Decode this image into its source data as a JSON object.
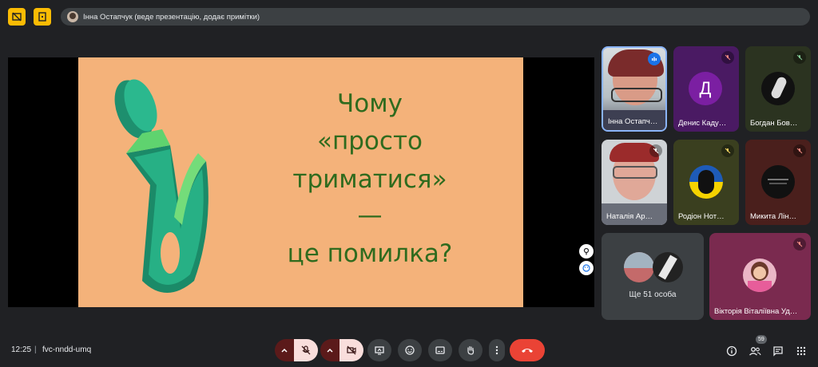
{
  "top_bar": {
    "presenter_label": "Інна Остапчук (веде презентацію, додає примітки)"
  },
  "slide": {
    "line1": "Чому",
    "line2": "«просто",
    "line3": "триматися»",
    "line4": "—",
    "line5": "це  помилка?"
  },
  "participants": {
    "tiles": [
      {
        "name": "Інна Остапч…"
      },
      {
        "name": "Денис Каду…",
        "initial": "Д"
      },
      {
        "name": "Богдан Бов…"
      },
      {
        "name": "Наталія Ар…"
      },
      {
        "name": "Родіон Нот…"
      },
      {
        "name": "Микита Лін…"
      }
    ],
    "others_label": "Ще 51 особа",
    "last_tile_name": "Вікторія Віталіївна Уд…"
  },
  "bottom_bar": {
    "time": "12:25",
    "separator": "|",
    "meeting_code": "fvc-nndd-umq",
    "people_count": "59"
  },
  "colors": {
    "background": "#202124",
    "slide_bg": "#f4b27a",
    "slide_text": "#2f6b1e",
    "end_call": "#ea4335",
    "accent_yellow": "#fbbc04"
  }
}
